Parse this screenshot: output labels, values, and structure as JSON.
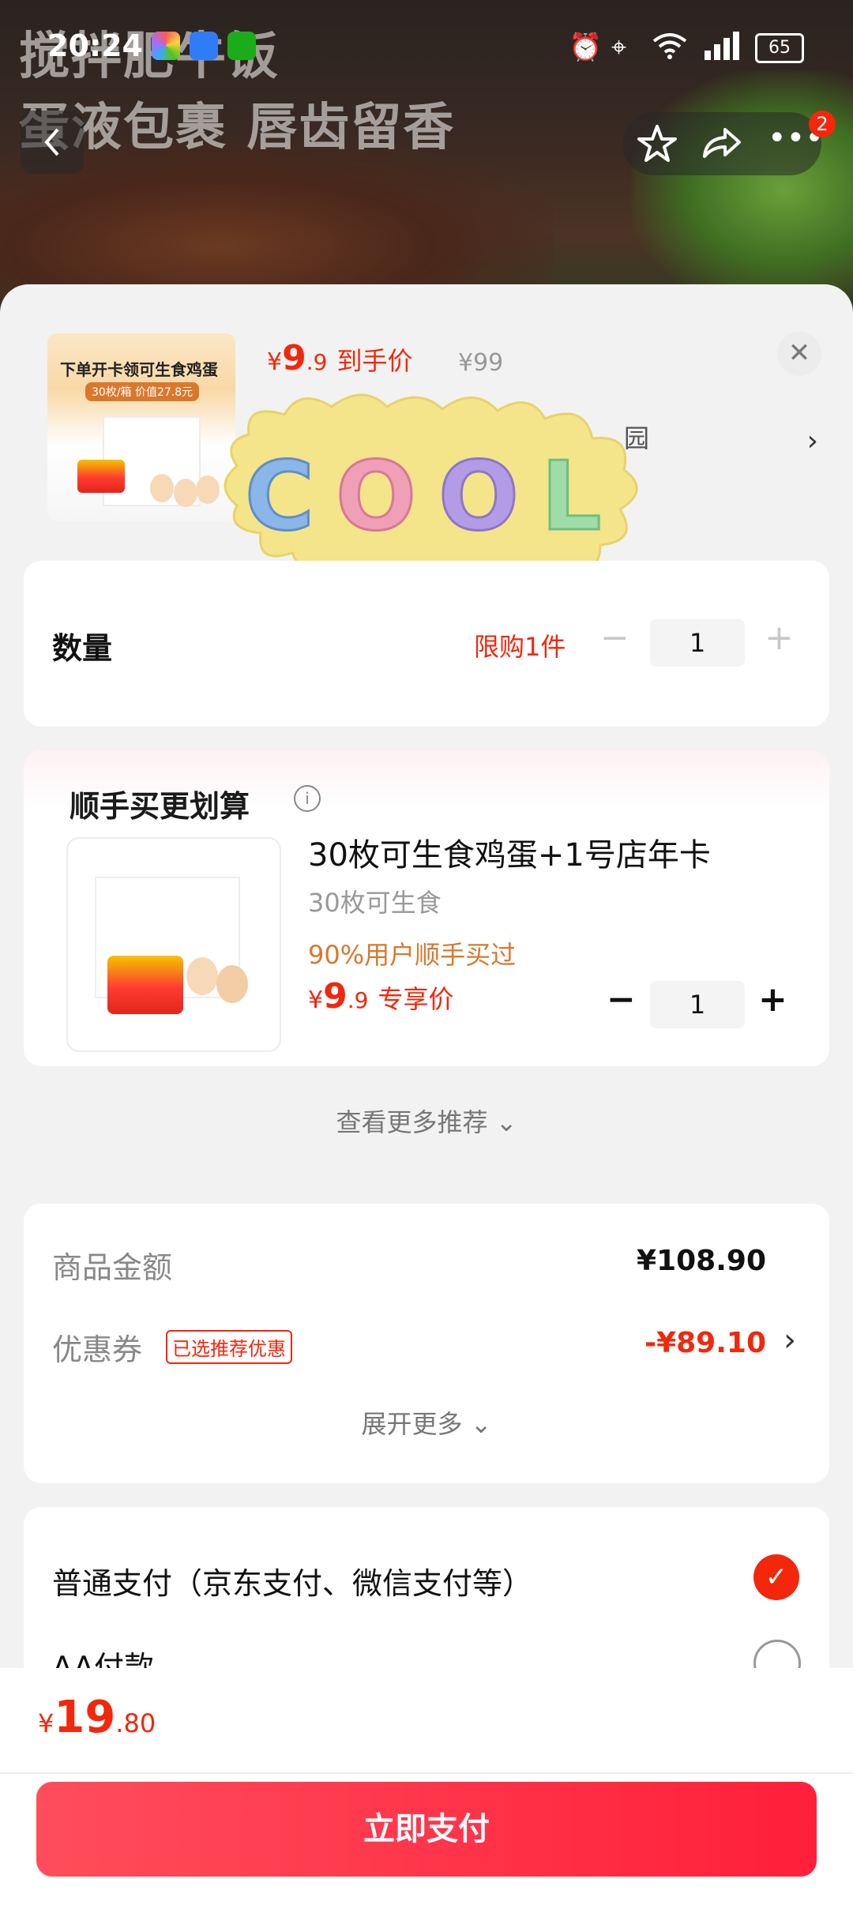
{
  "status_bar": {
    "time": "20:24",
    "battery": "65"
  },
  "banner": {
    "line1": "搅拌肥牛饭",
    "line2": "蛋液包裹 唇齿留香"
  },
  "top_nav": {
    "badge": "2"
  },
  "product": {
    "thumb_title": "下单开卡领可生食鸡蛋",
    "thumb_sub": "30枚/箱  价值27.8元",
    "price_symbol": "¥",
    "price_int": "9",
    "price_dec": ".9",
    "price_label": "到手价",
    "original_price": "¥99",
    "address_partial": "园"
  },
  "sticker": {
    "text": "COOL"
  },
  "quantity": {
    "label": "数量",
    "limit": "限购1件",
    "value": "1",
    "minus": "−",
    "plus": "+"
  },
  "recommend": {
    "title": "顺手买更划算",
    "item_name": "30枚可生食鸡蛋+1号店年卡",
    "item_sub": "30枚可生食",
    "item_note": "90%用户顺手买过",
    "price_symbol": "¥",
    "price_int": "9",
    "price_dec": ".9",
    "price_label": "专享价",
    "qty": "1",
    "more": "查看更多推荐"
  },
  "summary": {
    "goods_label": "商品金额",
    "goods_value": "¥108.90",
    "coupon_label": "优惠券",
    "coupon_tag": "已选推荐优惠",
    "coupon_value": "-¥89.10",
    "expand": "展开更多"
  },
  "payment": {
    "option1": "普通支付（京东支付、微信支付等）",
    "option2": "AA付款",
    "selected": 1
  },
  "footer": {
    "total_symbol": "¥",
    "total_int": "19",
    "total_dec": ".80",
    "pay_button": "立即支付"
  },
  "colors": {
    "accent": "#f2270c",
    "orange": "#d9782d",
    "pay_button": "#ff2b40"
  }
}
